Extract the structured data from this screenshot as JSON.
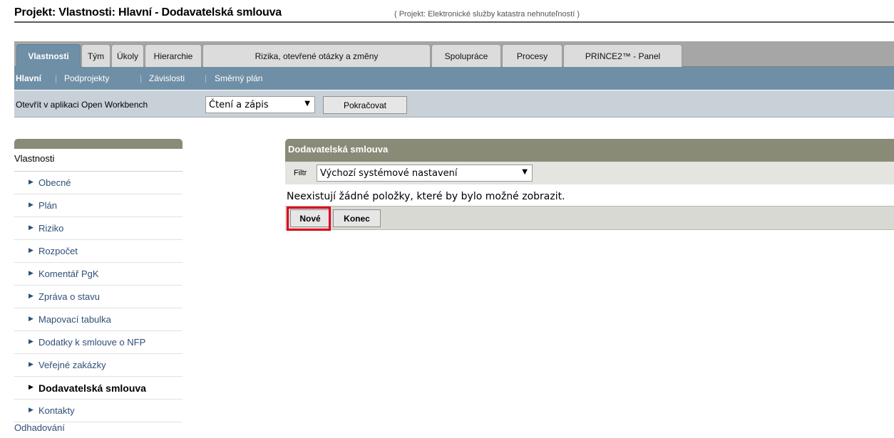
{
  "header": {
    "title": "Projekt: Vlastnosti: Hlavní - Dodavatelská smlouva",
    "subtitle": "( Projekt: Elektronické služby katastra nehnuteľností )"
  },
  "tabs": [
    {
      "label": "Vlastnosti",
      "active": true
    },
    {
      "label": "Tým"
    },
    {
      "label": "Úkoly"
    },
    {
      "label": "Hierarchie"
    },
    {
      "label": "Rizika, otevřené otázky a změny"
    },
    {
      "label": "Spolupráce"
    },
    {
      "label": "Procesy"
    },
    {
      "label": "PRINCE2™ - Panel"
    }
  ],
  "subnav": [
    {
      "label": "Hlavní",
      "active": true
    },
    {
      "label": "Podprojekty"
    },
    {
      "label": "Závislosti"
    },
    {
      "label": "Směrný plán"
    }
  ],
  "subnav_separator": "|",
  "openbar": {
    "label": "Otevřít v aplikaci Open Workbench",
    "mode_value": "Čtení a zápis",
    "continue_label": "Pokračovat"
  },
  "sidebar": {
    "header": "Vlastnosti",
    "items": [
      {
        "label": "Obecné"
      },
      {
        "label": "Plán"
      },
      {
        "label": "Riziko"
      },
      {
        "label": "Rozpočet"
      },
      {
        "label": "Komentář PgK"
      },
      {
        "label": "Zpráva o stavu"
      },
      {
        "label": "Mapovací tabulka"
      },
      {
        "label": "Dodatky k smlouve o NFP"
      },
      {
        "label": "Veřejné zakázky"
      },
      {
        "label": "Dodavatelská smlouva",
        "current": true
      },
      {
        "label": "Kontakty"
      }
    ],
    "footer": "Odhadování",
    "bullet": "▶"
  },
  "main": {
    "panel_title": "Dodavatelská smlouva",
    "filter_label": "Filtr",
    "filter_value": "Výchozí systémové nastavení",
    "empty_message": "Neexistují žádné položky, které by bylo možné zobrazit.",
    "new_label": "Nové",
    "end_label": "Konec"
  },
  "colors": {
    "accent": "#6f8fa7",
    "panel_header": "#8a8b77",
    "highlight": "#e0001a",
    "link": "#2e4f77"
  }
}
